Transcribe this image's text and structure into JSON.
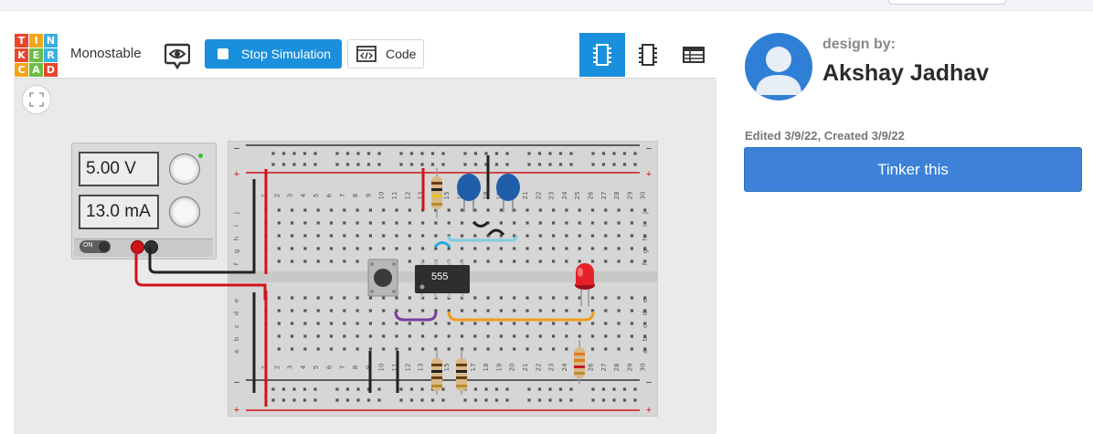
{
  "header": {
    "logo_letters": [
      "T",
      "I",
      "N",
      "K",
      "E",
      "R",
      "C",
      "A",
      "D"
    ],
    "logo_colors": [
      "#e8452c",
      "#f4a51c",
      "#3ab0e2",
      "#e8452c",
      "#6abe45",
      "#3ab0e2",
      "#f4a51c",
      "#6abe45",
      "#e8452c"
    ],
    "project_title": "Monostable",
    "stop_label": "Stop Simulation",
    "code_label": "Code"
  },
  "icons": {
    "eye": "eye-speech-icon",
    "code": "code-window-icon",
    "schematic_view": "breadboard-view-icon",
    "component_view": "chip-view-icon",
    "list_view": "component-list-icon",
    "fit": "fit-to-view-icon"
  },
  "power_supply": {
    "voltage": "5.00 V",
    "current": "13.0 mA",
    "switch_label": "ON"
  },
  "circuit": {
    "chip_label": "555",
    "column_numbers": [
      "1",
      "2",
      "3",
      "4",
      "5",
      "6",
      "7",
      "8",
      "9",
      "10",
      "11",
      "12",
      "13",
      "14",
      "15",
      "16",
      "17",
      "18",
      "19",
      "20",
      "21",
      "22",
      "23",
      "24",
      "25",
      "26",
      "27",
      "28",
      "29",
      "30"
    ],
    "row_letters_top": [
      "j",
      "i",
      "h",
      "g",
      "f"
    ],
    "row_letters_bottom": [
      "e",
      "d",
      "c",
      "b",
      "a"
    ]
  },
  "designer": {
    "label": "design by:",
    "name": "Akshay Jadhav",
    "dates": "Edited 3/9/22, Created 3/9/22",
    "tinker_label": "Tinker this"
  },
  "colors": {
    "accent": "#1a8fdc",
    "tinker_button": "#3d82d8",
    "avatar": "#2f7fd6"
  }
}
